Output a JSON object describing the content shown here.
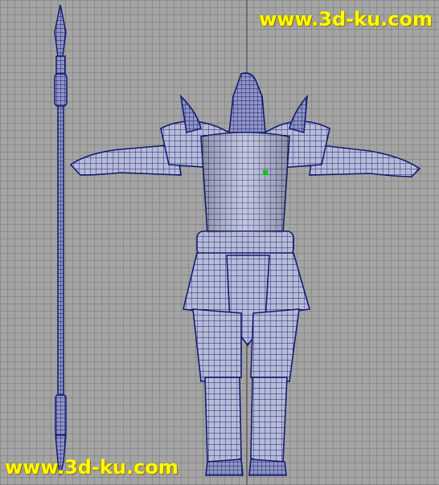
{
  "watermark_top": "www.3d-ku.com",
  "watermark_bottom": "www.3d-ku.com",
  "colors": {
    "background": "#a4a4a4",
    "grid": "#787878",
    "mesh_fill": "#b9bfd6",
    "wireframe": "#141a74",
    "watermark": "#ffff00"
  }
}
